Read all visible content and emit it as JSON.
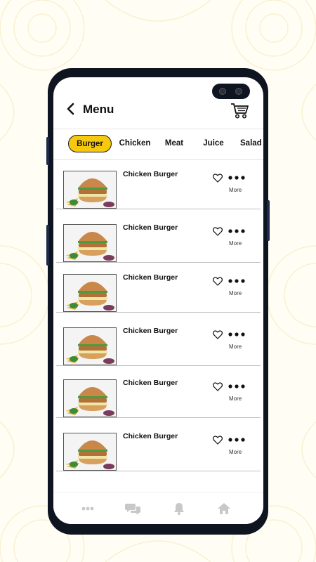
{
  "header": {
    "title": "Menu"
  },
  "tabs": [
    {
      "label": "Burger",
      "active": true
    },
    {
      "label": "Chicken",
      "active": false
    },
    {
      "label": "Meat",
      "active": false
    },
    {
      "label": "Juice",
      "active": false
    },
    {
      "label": "Salad",
      "active": false
    }
  ],
  "items": [
    {
      "name": "Chicken Burger",
      "more_label": "More"
    },
    {
      "name": "Chicken Burger",
      "more_label": "More"
    },
    {
      "name": "Chicken Burger",
      "more_label": "More"
    },
    {
      "name": "Chicken Burger",
      "more_label": "More"
    },
    {
      "name": "Chicken Burger",
      "more_label": "More"
    },
    {
      "name": "Chicken Burger",
      "more_label": "More"
    }
  ],
  "bottom_nav": [
    {
      "icon": "more-dots-icon"
    },
    {
      "icon": "chat-icon"
    },
    {
      "icon": "bell-icon"
    },
    {
      "icon": "home-icon"
    }
  ],
  "colors": {
    "accent": "#f6c90e",
    "background": "#fffdf4",
    "phone_frame": "#0e1420",
    "nav_icon": "#c8c8c8"
  }
}
